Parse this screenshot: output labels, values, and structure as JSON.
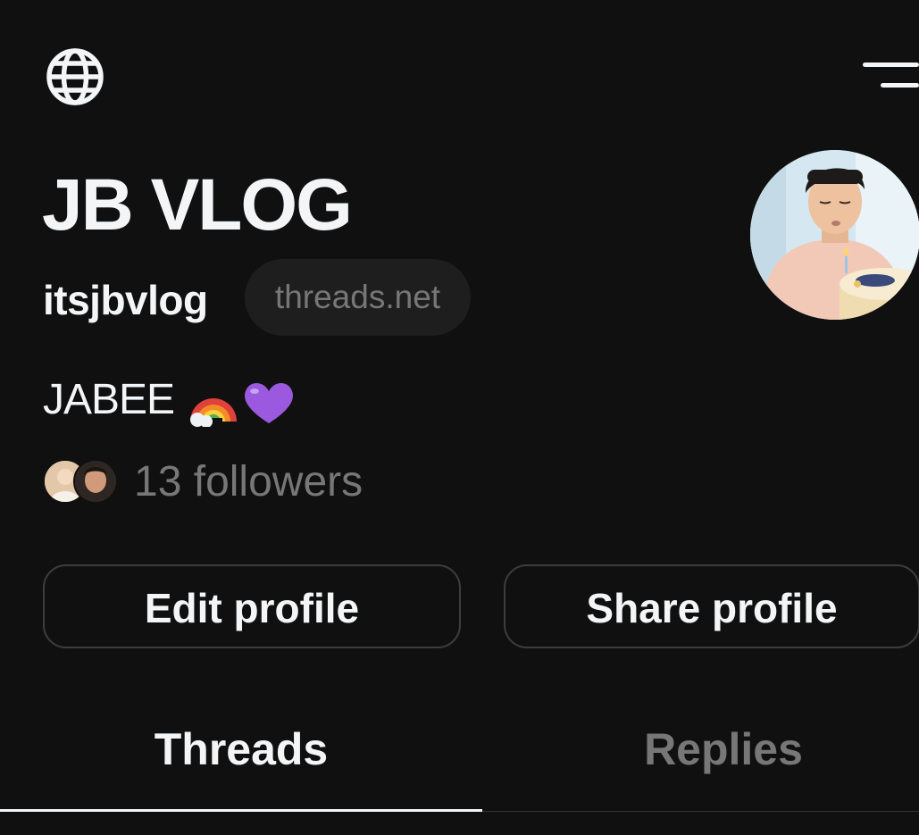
{
  "header": {
    "left_icon": "globe-icon",
    "right_icon": "menu-icon"
  },
  "profile": {
    "display_name": "JB VLOG",
    "username": "itsjbvlog",
    "domain_chip": "threads.net",
    "bio": "JABEE",
    "bio_emoji": [
      "rainbow-emoji",
      "purple-heart-emoji"
    ],
    "followers_text": "13 followers"
  },
  "actions": {
    "edit_label": "Edit profile",
    "share_label": "Share profile"
  },
  "tabs": [
    {
      "label": "Threads",
      "active": true
    },
    {
      "label": "Replies",
      "active": false
    }
  ],
  "colors": {
    "background": "#101010",
    "primary_text": "#f3f5f7",
    "secondary_text": "#777777",
    "border": "#3d3d3d"
  }
}
